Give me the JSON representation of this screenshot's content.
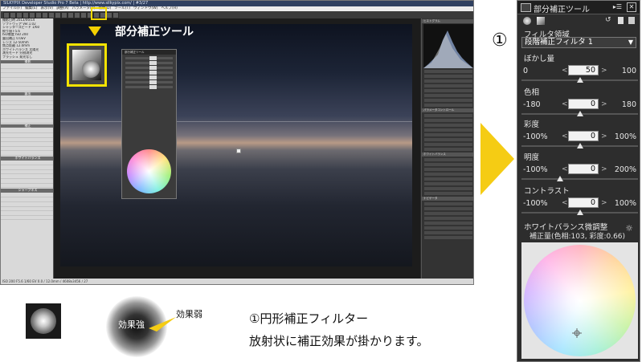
{
  "app": {
    "title": "SILKYPIX Developer Studio Pro 7 Beta | http://www.silkypix.com/ | #3/27",
    "menu": [
      "ファイル(F)",
      "編集(E)",
      "表示(V)",
      "調整(A)",
      "パラメータ(P)",
      "現像(D)",
      "ツール(T)",
      "ウィンドウ(W)",
      "ヘルプ(H)"
    ],
    "left_panel_rows": [
      "撮影日時 2013/06/14",
      "ソフトウェア Ver.1.02",
      "シャッタースピード 1/60",
      "絞り値 F5.6",
      "ISO感度 ISO 200",
      "露出補正 0.0EV",
      "レンズ 12-50mm",
      "焦点距離 12.0mm",
      "ホワイトバランス 太陽光",
      "測光モード 分割測光",
      "フラッシュ 発光なし"
    ],
    "left_panel_sections": [
      "撮影",
      "露出",
      "補正",
      "ホワイトバランス",
      "シャープネス"
    ],
    "right_panel_headings": [
      "ヒストグラム",
      "パラメータコントロール",
      "ホワイトバランス",
      "ナビゲータ"
    ],
    "status": "ISO 200 F5.6 1/60 EV 0.0 / 12.0mm / 4608x3456 / 27"
  },
  "annotation": {
    "title": "部分補正ツール",
    "badge": "①"
  },
  "mini_panel": {
    "title": "部分補正ツール"
  },
  "palette": {
    "title": "部分補正ツール",
    "pin": "▸☰",
    "close": "✕",
    "filter_label": "フィルタ領域",
    "filter_value": "段階補正フィルタ 1",
    "sliders": [
      {
        "label": "ぼかし量",
        "min": "0",
        "max": "100",
        "value": "50",
        "fraction": 0.5
      },
      {
        "label": "色相",
        "min": "-180",
        "max": "180",
        "value": "0",
        "fraction": 0.5
      },
      {
        "label": "彩度",
        "min": "-100%",
        "max": "100%",
        "value": "0",
        "fraction": 0.5
      },
      {
        "label": "明度",
        "min": "-100%",
        "max": "200%",
        "value": "0",
        "fraction": 0.333
      },
      {
        "label": "コントラスト",
        "min": "-100%",
        "max": "100%",
        "value": "0",
        "fraction": 0.5
      }
    ],
    "wb_heading": "ホワイトバランス微調整",
    "wb_values": "補正量(色相:103, 彩度:0.66)"
  },
  "legend": {
    "strong": "効果強",
    "weak": "効果弱",
    "line1": "①円形補正フィルター",
    "line2": "放射状に補正効果が掛かります。"
  },
  "colors": {
    "accent_yellow": "#f5cc14",
    "palette_bg": "#2d2d2d"
  }
}
